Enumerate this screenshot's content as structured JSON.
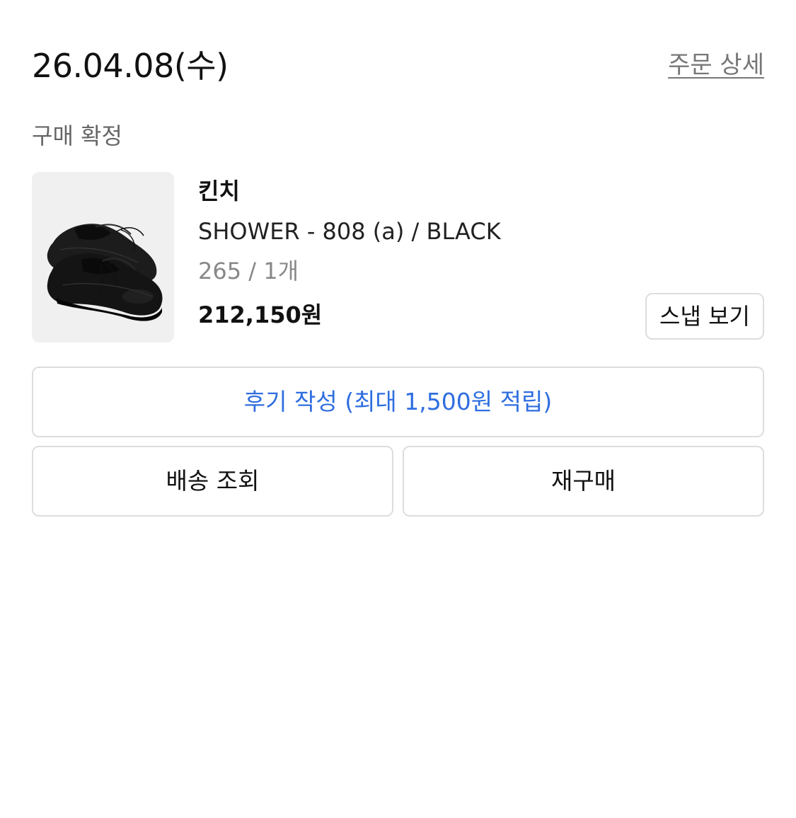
{
  "order": {
    "date": "26.04.08(수)",
    "detail_link": "주문 상세",
    "status": "구매 확정"
  },
  "product": {
    "image_icon": "black-leather-shoes-image",
    "brand": "킨치",
    "name": "SHOWER - 808 (a) / BLACK",
    "option": "265 / 1개",
    "price": "212,150원",
    "snap_label": "스냅 보기"
  },
  "actions": {
    "review_label": "후기 작성 (최대 1,500원 적립)",
    "tracking_label": "배송 조회",
    "rebuy_label": "재구매"
  },
  "colors": {
    "accent_blue": "#2f6ee0",
    "border": "#dddddd",
    "thumb_bg": "#f0f0f0",
    "muted_text": "#888888"
  }
}
